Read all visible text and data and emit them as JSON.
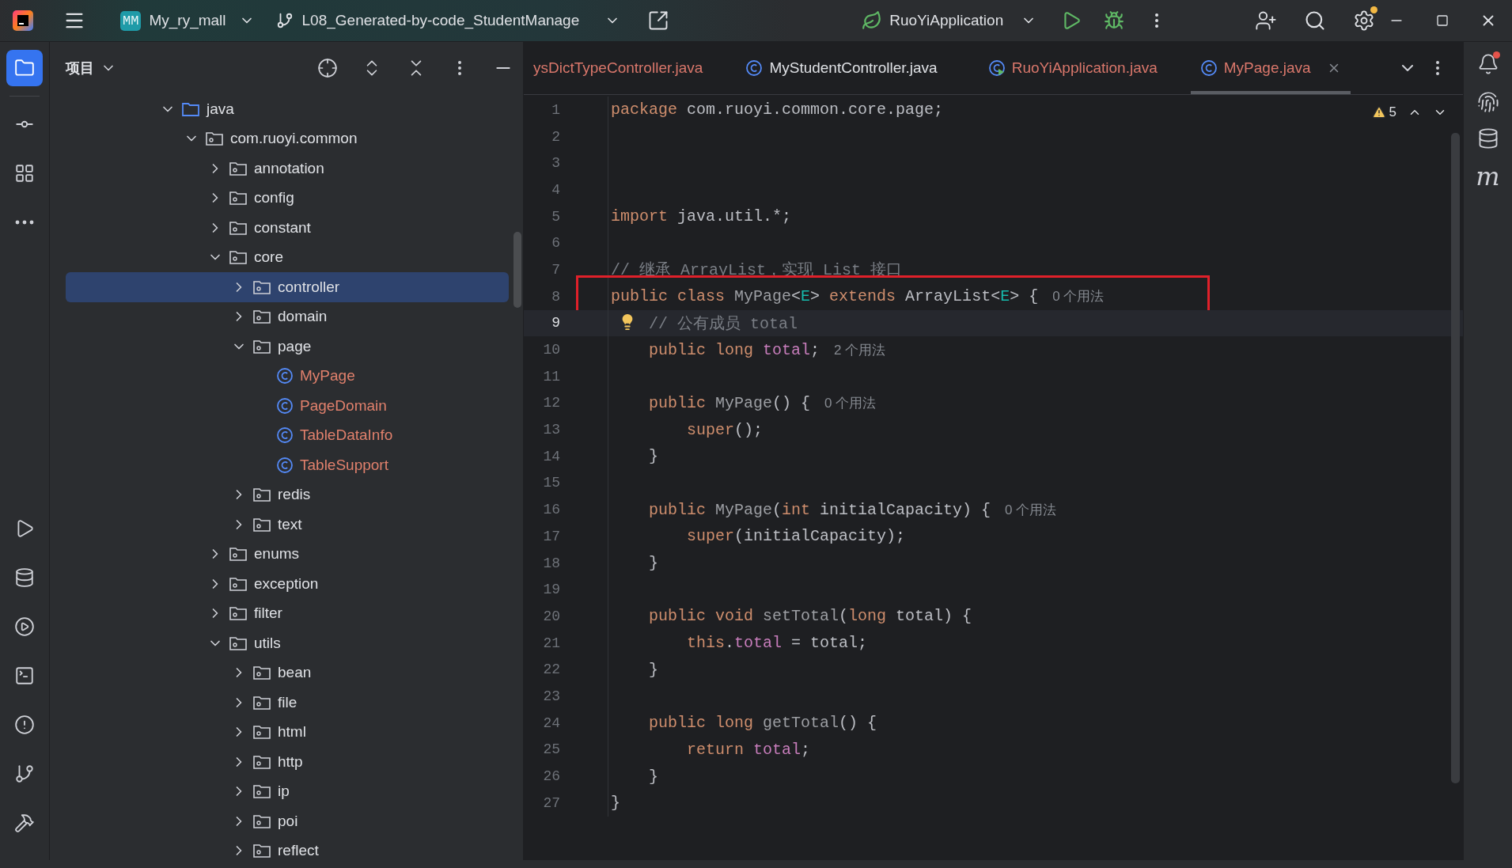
{
  "title_bar": {
    "project_badge": "MM",
    "project": "My_ry_mall",
    "branch": "L08_Generated-by-code_StudentManage",
    "run_config": "RuoYiApplication"
  },
  "left_toolbar": {
    "top": [
      {
        "kind": "project",
        "selected": true
      },
      {
        "kind": "commit",
        "selected": false
      },
      {
        "kind": "structure",
        "selected": false
      },
      {
        "kind": "more",
        "selected": false
      }
    ],
    "bottom": [
      {
        "kind": "run",
        "selected": false
      },
      {
        "kind": "database",
        "selected": false
      },
      {
        "kind": "services",
        "selected": false
      },
      {
        "kind": "terminal",
        "selected": false
      },
      {
        "kind": "problems",
        "selected": false
      },
      {
        "kind": "git",
        "selected": false
      },
      {
        "kind": "build",
        "selected": false
      }
    ]
  },
  "project_panel": {
    "title": "项目",
    "tree": [
      {
        "label": "java",
        "kind": "source_root",
        "expanded": true,
        "selected": false,
        "children": [
          {
            "label": "com.ruoyi.common",
            "kind": "package",
            "expanded": true,
            "selected": false,
            "children": [
              {
                "label": "annotation",
                "kind": "package",
                "expanded": false,
                "selected": false
              },
              {
                "label": "config",
                "kind": "package",
                "expanded": false,
                "selected": false
              },
              {
                "label": "constant",
                "kind": "package",
                "expanded": false,
                "selected": false
              },
              {
                "label": "core",
                "kind": "package",
                "expanded": true,
                "selected": false,
                "children": [
                  {
                    "label": "controller",
                    "kind": "package",
                    "expanded": false,
                    "selected": true
                  },
                  {
                    "label": "domain",
                    "kind": "package",
                    "expanded": false,
                    "selected": false
                  },
                  {
                    "label": "page",
                    "kind": "package",
                    "expanded": true,
                    "selected": false,
                    "children": [
                      {
                        "label": "MyPage",
                        "kind": "class",
                        "selected": false
                      },
                      {
                        "label": "PageDomain",
                        "kind": "class",
                        "selected": false
                      },
                      {
                        "label": "TableDataInfo",
                        "kind": "class",
                        "selected": false
                      },
                      {
                        "label": "TableSupport",
                        "kind": "class",
                        "selected": false
                      }
                    ]
                  },
                  {
                    "label": "redis",
                    "kind": "package",
                    "expanded": false,
                    "selected": false
                  },
                  {
                    "label": "text",
                    "kind": "package",
                    "expanded": false,
                    "selected": false
                  }
                ]
              },
              {
                "label": "enums",
                "kind": "package",
                "expanded": false,
                "selected": false
              },
              {
                "label": "exception",
                "kind": "package",
                "expanded": false,
                "selected": false
              },
              {
                "label": "filter",
                "kind": "package",
                "expanded": false,
                "selected": false
              },
              {
                "label": "utils",
                "kind": "package",
                "expanded": true,
                "selected": false,
                "children": [
                  {
                    "label": "bean",
                    "kind": "package",
                    "expanded": false,
                    "selected": false
                  },
                  {
                    "label": "file",
                    "kind": "package",
                    "expanded": false,
                    "selected": false
                  },
                  {
                    "label": "html",
                    "kind": "package",
                    "expanded": false,
                    "selected": false
                  },
                  {
                    "label": "http",
                    "kind": "package",
                    "expanded": false,
                    "selected": false
                  },
                  {
                    "label": "ip",
                    "kind": "package",
                    "expanded": false,
                    "selected": false
                  },
                  {
                    "label": "poi",
                    "kind": "package",
                    "expanded": false,
                    "selected": false
                  },
                  {
                    "label": "reflect",
                    "kind": "package",
                    "expanded": false,
                    "selected": false
                  }
                ]
              }
            ]
          }
        ]
      }
    ]
  },
  "editor": {
    "tabs": [
      {
        "label": "ysDictTypeController.java",
        "kind": "partial",
        "selected": false,
        "color": "#d9776b"
      },
      {
        "label": "MyStudentController.java",
        "kind": "class",
        "selected": false,
        "color": "#dfe1e5"
      },
      {
        "label": "RuoYiApplication.java",
        "kind": "application",
        "selected": false,
        "color": "#d9776b"
      },
      {
        "label": "MyPage.java",
        "kind": "class",
        "selected": true,
        "color": "#d9776b"
      }
    ],
    "warnings": "5",
    "lines": [
      {
        "number": "1",
        "segments": [
          {
            "kind": "keyword",
            "text": "package"
          },
          {
            "kind": "plain",
            "text": " com.ruoyi.common.core.page;"
          }
        ]
      },
      {
        "number": "2"
      },
      {
        "number": "3"
      },
      {
        "number": "4"
      },
      {
        "number": "5",
        "segments": [
          {
            "kind": "keyword",
            "text": "import"
          },
          {
            "kind": "plain",
            "text": " java.util.*;"
          }
        ]
      },
      {
        "number": "6"
      },
      {
        "number": "7",
        "segments": [
          {
            "kind": "comment",
            "text": "// 继承 ArrayList，实现 List 接口"
          }
        ]
      },
      {
        "number": "8",
        "boxed": true,
        "segments": [
          {
            "kind": "keyword",
            "text": "public class "
          },
          {
            "kind": "unused",
            "text": "MyPage"
          },
          {
            "kind": "plain",
            "text": "<"
          },
          {
            "kind": "type_param",
            "text": "E"
          },
          {
            "kind": "plain",
            "text": "> "
          },
          {
            "kind": "keyword",
            "text": "extends"
          },
          {
            "kind": "plain",
            "text": " ArrayList<"
          },
          {
            "kind": "type_param",
            "text": "E"
          },
          {
            "kind": "plain",
            "text": "> {"
          }
        ],
        "hint": "0 个用法"
      },
      {
        "number": "9",
        "current": true,
        "intention": true,
        "segments": [
          {
            "kind": "comment",
            "text": "    // 公有成员 total"
          }
        ]
      },
      {
        "number": "10",
        "segments": [
          {
            "kind": "keyword",
            "text": "    public long "
          },
          {
            "kind": "field",
            "text": "total"
          },
          {
            "kind": "plain",
            "text": ";"
          }
        ],
        "hint": "2 个用法"
      },
      {
        "number": "11"
      },
      {
        "number": "12",
        "segments": [
          {
            "kind": "keyword",
            "text": "    public "
          },
          {
            "kind": "unused",
            "text": "MyPage"
          },
          {
            "kind": "plain",
            "text": "() {"
          }
        ],
        "hint": "0 个用法"
      },
      {
        "number": "13",
        "segments": [
          {
            "kind": "keyword",
            "text": "        super"
          },
          {
            "kind": "plain",
            "text": "();"
          }
        ]
      },
      {
        "number": "14",
        "segments": [
          {
            "kind": "plain",
            "text": "    }"
          }
        ]
      },
      {
        "number": "15"
      },
      {
        "number": "16",
        "segments": [
          {
            "kind": "keyword",
            "text": "    public "
          },
          {
            "kind": "unused",
            "text": "MyPage"
          },
          {
            "kind": "plain",
            "text": "("
          },
          {
            "kind": "keyword",
            "text": "int"
          },
          {
            "kind": "plain",
            "text": " initialCapacity) {"
          }
        ],
        "hint": "0 个用法"
      },
      {
        "number": "17",
        "segments": [
          {
            "kind": "keyword",
            "text": "        super"
          },
          {
            "kind": "plain",
            "text": "(initialCapacity);"
          }
        ]
      },
      {
        "number": "18",
        "segments": [
          {
            "kind": "plain",
            "text": "    }"
          }
        ]
      },
      {
        "number": "19"
      },
      {
        "number": "20",
        "segments": [
          {
            "kind": "keyword",
            "text": "    public void "
          },
          {
            "kind": "unused",
            "text": "setTotal"
          },
          {
            "kind": "plain",
            "text": "("
          },
          {
            "kind": "keyword",
            "text": "long"
          },
          {
            "kind": "plain",
            "text": " total) {"
          }
        ]
      },
      {
        "number": "21",
        "segments": [
          {
            "kind": "keyword",
            "text": "        this"
          },
          {
            "kind": "plain",
            "text": "."
          },
          {
            "kind": "field",
            "text": "total"
          },
          {
            "kind": "plain",
            "text": " = total;"
          }
        ]
      },
      {
        "number": "22",
        "segments": [
          {
            "kind": "plain",
            "text": "    }"
          }
        ]
      },
      {
        "number": "23"
      },
      {
        "number": "24",
        "segments": [
          {
            "kind": "keyword",
            "text": "    public long "
          },
          {
            "kind": "unused",
            "text": "getTotal"
          },
          {
            "kind": "plain",
            "text": "() {"
          }
        ]
      },
      {
        "number": "25",
        "segments": [
          {
            "kind": "keyword",
            "text": "        return "
          },
          {
            "kind": "field",
            "text": "total"
          },
          {
            "kind": "plain",
            "text": ";"
          }
        ]
      },
      {
        "number": "26",
        "segments": [
          {
            "kind": "plain",
            "text": "    }"
          }
        ]
      },
      {
        "number": "27",
        "segments": [
          {
            "kind": "plain",
            "text": "}"
          }
        ]
      }
    ]
  },
  "right_toolbar": {
    "maven_glyph": "m"
  }
}
